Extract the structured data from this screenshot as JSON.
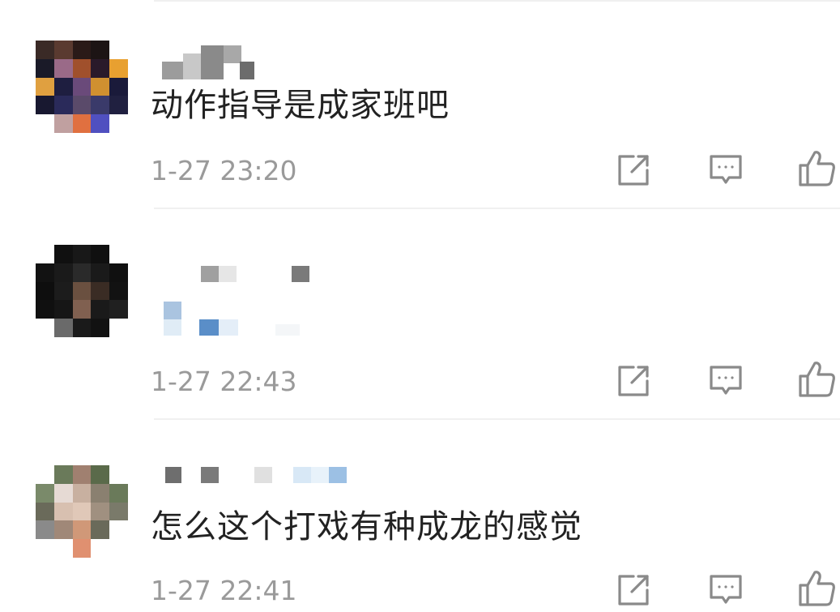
{
  "comments": [
    {
      "text": "动作指导是成家班吧",
      "time": "1-27  23:20",
      "actions": {
        "share": "share-icon",
        "reply": "comment-icon",
        "like": "thumbs-up-icon"
      }
    },
    {
      "text": "",
      "time": "1-27  22:43",
      "actions": {
        "share": "share-icon",
        "reply": "comment-icon",
        "like": "thumbs-up-icon"
      }
    },
    {
      "text": "怎么这个打戏有种成龙的感觉",
      "time": "1-27  22:41",
      "actions": {
        "share": "share-icon",
        "reply": "comment-icon",
        "like": "thumbs-up-icon"
      }
    }
  ],
  "colors": {
    "text": "#222222",
    "timestamp": "#9a9a9a",
    "icon": "#8a8a8a",
    "divider": "#f0f0f0"
  }
}
